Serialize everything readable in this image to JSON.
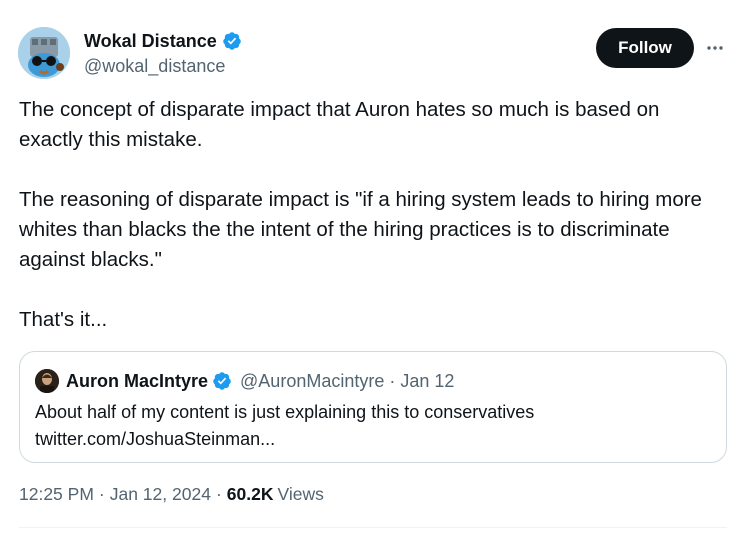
{
  "author": {
    "name": "Wokal Distance",
    "handle": "@wokal_distance",
    "verified": true
  },
  "actions": {
    "follow_label": "Follow",
    "more_icon": "more-horizontal-icon"
  },
  "tweet": {
    "paragraphs": [
      "The concept of disparate impact that Auron hates so much is based on exactly this mistake.",
      "The reasoning of disparate impact is \"if a hiring system leads to hiring more whites than blacks the  the intent of the hiring practices is to discriminate against blacks.\"",
      "That's it..."
    ]
  },
  "quoted": {
    "name": "Auron MacIntyre",
    "handle_date": "@AuronMacintyre · Jan 12",
    "verified": true,
    "text_line1": "About half of my content is just explaining this to conservatives",
    "text_line2": "twitter.com/JoshuaSteinman..."
  },
  "meta": {
    "time": "12:25 PM",
    "date": "Jan 12, 2024",
    "views_count": "60.2K",
    "views_label": "Views"
  },
  "colors": {
    "verified_blue": "#1d9bf0",
    "text_primary": "#0f1419",
    "text_secondary": "#536471"
  }
}
